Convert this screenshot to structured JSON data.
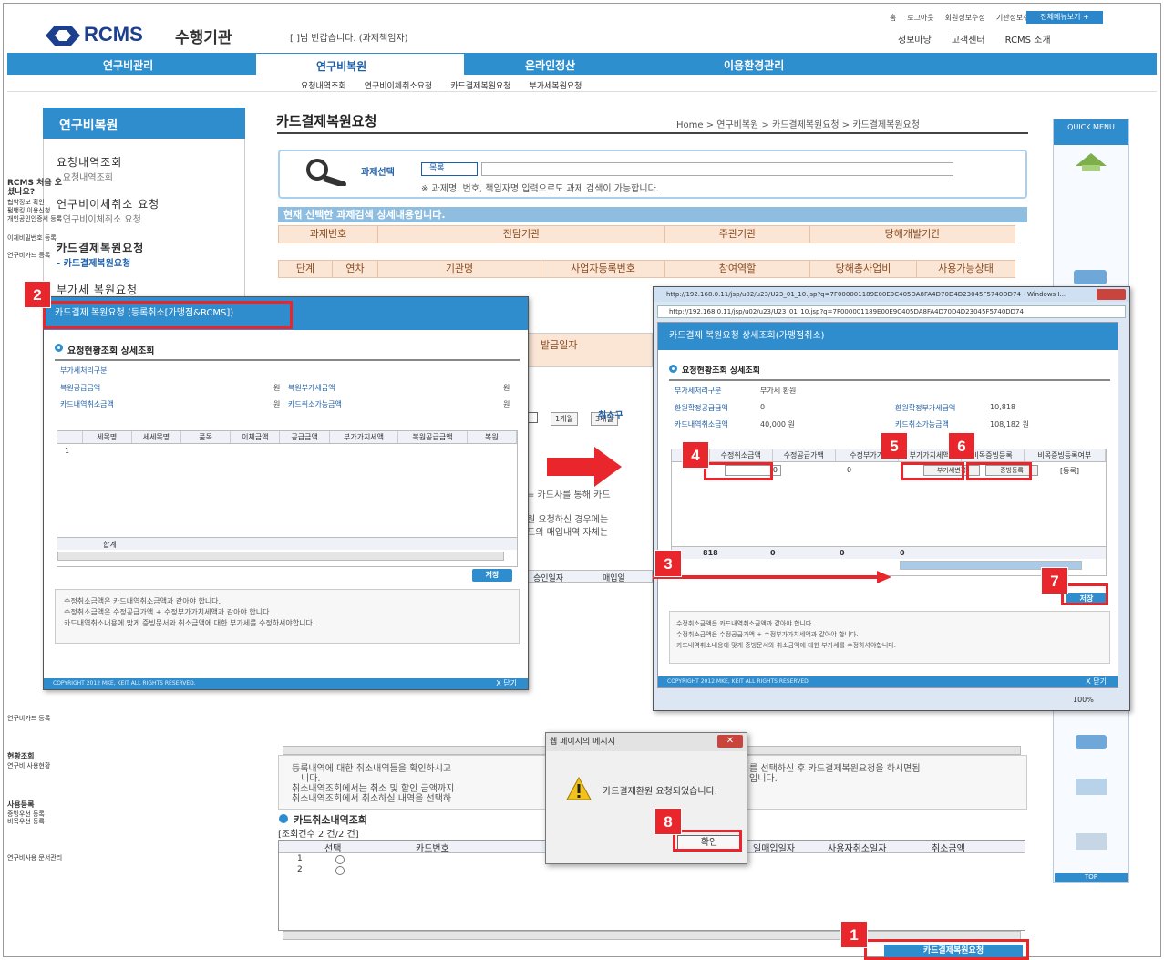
{
  "header": {
    "logo": "RCMS",
    "subtitle": "수행기관",
    "greeting": "[              ]님 반갑습니다. (과제책임자)",
    "top_links": [
      "홈",
      "로그아웃",
      "회원정보수정",
      "기관정보수정"
    ],
    "all_menu": "전체메뉴보기 +",
    "sub_links": [
      "정보마당",
      "고객센터",
      "RCMS 소개"
    ]
  },
  "gnb": [
    "연구비관리",
    "연구비복원",
    "온라인정산",
    "이용환경관리"
  ],
  "lnb": [
    "요청내역조회",
    "연구비이체취소요청",
    "카드결제복원요청",
    "부가세복원요청"
  ],
  "left_menu": {
    "title": "연구비복원",
    "items": [
      {
        "label": "요청내역조회",
        "sub": "- 요청내역조회"
      },
      {
        "label": "연구비이체취소 요청",
        "sub": "- 연구비이체취소 요청"
      },
      {
        "label": "카드결제복원요청",
        "sub": "- 카드결제복원요청"
      },
      {
        "label": "부가세 복원요청",
        "sub": ""
      }
    ]
  },
  "page": {
    "title": "카드결제복원요청",
    "breadcrumb": "Home > 연구비복원 > 카드결제복원요청 > 카드결제복원요청",
    "search_label": "과제선택",
    "search_select": "목록",
    "search_hint": "※ 과제명, 번호, 책임자명 입력으로도 과제 검색이 가능합니다.",
    "section_bar": "현재 선택한 과제검색 상세내용입니다.",
    "head_row1": [
      "과제번호",
      "전담기관",
      "주관기관",
      "당해개발기간"
    ],
    "head_row2": [
      "단계",
      "연차",
      "기관명",
      "사업자등록번호",
      "참여역할",
      "당해총사업비",
      "사용가능상태"
    ],
    "period_buttons": [
      "1개월",
      "3개월"
    ],
    "cancel_type_label": "취소구",
    "issue_date": "발급일자",
    "approve_date": "승인일자",
    "purchase_date": "매입일",
    "card_text_1": "= 카드사를 통해 카드",
    "card_text_2": "원 요청하신 경우에는",
    "card_text_3": "드의 매입내역 자체는",
    "notes": [
      "등록내역에 대한 취소내역들을 확인하시고",
      "니다.",
      "취소내역조회에서는 취소 및 할인 금액까지",
      "취소내역조회에서 취소하실 내역을 선택하"
    ],
    "notes_right": [
      "를 선택하신 후 카드결제복원요청을 하시면됨",
      "",
      "",
      "입니다."
    ],
    "cancel_list_title": "카드취소내역조회",
    "cancel_list_count": "[조회건수 2 건/2 건]",
    "cancel_cols": [
      "선택",
      "카드번호",
      "",
      "일매입일자",
      "사용자취소일자",
      "취소금액"
    ],
    "cancel_rows": [
      "1",
      "2"
    ],
    "request_button": "카드결제복원요청"
  },
  "quick_menu": {
    "title": "QUICK MENU",
    "items": [
      "RCMS 처음 오셨나요?",
      "협약정보 확인",
      "펌뱅킹 이용신청",
      "개인공인인증서 등록",
      "이체비밀번호 등록",
      "연구비카드 등록",
      "연구비카드 등록",
      "현황조회",
      "연구비 사용현황",
      "사용등록",
      "증빙우선 등록",
      "비목우선 등록",
      "연구비사용 문서관리",
      "TOP"
    ]
  },
  "popup_left": {
    "title": "카드결제 복원요청 (등록취소[가맹점&RCMS])",
    "subtitle": "요청현황조회 상세조회",
    "rows": [
      {
        "label": "부가세처리구분",
        "value": ""
      },
      {
        "label": "복원공급금액",
        "value": "원",
        "label2": "복원부가세금액",
        "value2": "원"
      },
      {
        "label": "카드내역취소금액",
        "value": "원",
        "label2": "카드취소가능금액",
        "value2": "원"
      }
    ],
    "columns": [
      "세목명",
      "세세목명",
      "품목",
      "이체금액",
      "공급금액",
      "부가가치세액",
      "복원공급금액",
      "복원"
    ],
    "row_num": "1",
    "total_label": "합계",
    "save": "저장",
    "notes": [
      "수정취소금액은 카드내역취소금액과 같아야 합니다.",
      "수정취소금액은 수정공급가액 + 수정부가가치세액과 같아야 합니다.",
      "카드내역취소내용에 맞게 증빙문서와 취소금액에 대한 부가세를 수정하셔야합니다."
    ],
    "copyright": "COPYRIGHT 2012 MKE, KEIT ALL RIGHTS RESERVED.",
    "close": "X 닫기"
  },
  "popup_right": {
    "url_title": "http://192.168.0.11/jsp/u02/u23/U23_01_10.jsp?q=7F000001189E00E9C405DA8FA4D70D4D23045F5740DD74 - Windows I...",
    "url": "http://192.168.0.11/jsp/u02/u23/U23_01_10.jsp?q=7F000001189E00E9C405DA8FA4D70D4D23045F5740DD74",
    "title": "카드결제 복원요청 상세조회(가맹점취소)",
    "subtitle": "요청현황조회 상세조회",
    "rows": [
      {
        "label": "부가세처리구분",
        "value": "부가세 환원"
      },
      {
        "label": "환원확정공급금액",
        "value": "0",
        "label2": "환원확정부가세금액",
        "value2": "10,818"
      },
      {
        "label": "카드내역취소금액",
        "value": "40,000 원",
        "label2": "카드취소가능금액",
        "value2": "108,182 원"
      }
    ],
    "columns": [
      "수정취소금액",
      "수정공급가액",
      "수정부가가",
      "부가가치세액",
      "비목증빙등록",
      "비목증빙등록여부"
    ],
    "first_row": [
      "0",
      "0",
      "",
      "부가세변경",
      "증빙등록",
      "[등록]"
    ],
    "total_row": [
      "818",
      "0",
      "0",
      "0"
    ],
    "save": "저장",
    "notes": [
      "수정취소금액은 카드내역취소금액과 같아야 합니다.",
      "수정취소금액은 수정공급가액 + 수정부가가치세액과 같아야 합니다.",
      "카드내역취소내용에 맞게 증빙문서와 취소금액에 대한 부가세를 수정하셔야합니다."
    ],
    "copyright": "COPYRIGHT 2012 MKE, KEIT ALL RIGHTS RESERVED.",
    "close": "X 닫기",
    "zoom": "100%"
  },
  "dialog": {
    "title": "웹 페이지의 메시지",
    "message": "카드결제환원 요청되었습니다.",
    "ok": "확인"
  },
  "steps": [
    "1",
    "2",
    "3",
    "4",
    "5",
    "6",
    "7",
    "8"
  ],
  "colors": {
    "accent": "#2f8dce",
    "marker": "#e8262c",
    "brand": "#1c3f8e"
  }
}
